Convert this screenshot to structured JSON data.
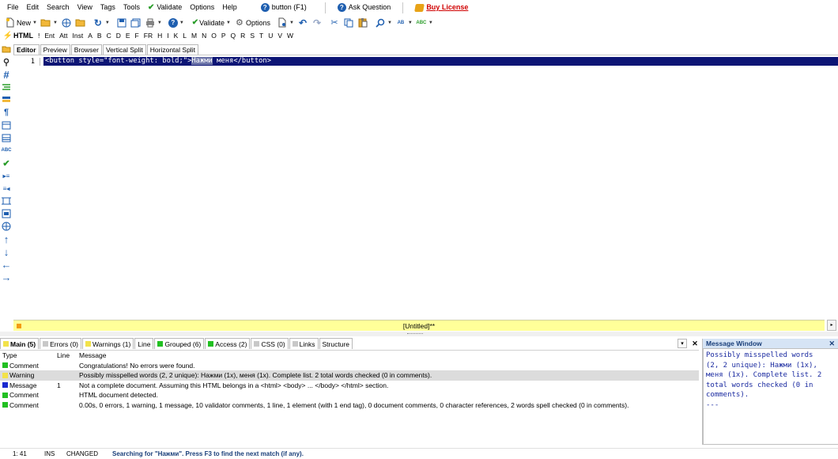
{
  "menu": {
    "file": "File",
    "edit": "Edit",
    "search": "Search",
    "view": "View",
    "tags": "Tags",
    "tools": "Tools",
    "validate": "Validate",
    "options": "Options",
    "help": "Help",
    "context_help": "button (F1)",
    "ask_question": "Ask Question",
    "buy_license": "Buy License"
  },
  "toolbar": {
    "new_label": "New",
    "validate_label": "Validate",
    "options_label": "Options"
  },
  "tagbar": {
    "items": [
      "HTML",
      "!",
      "Ent",
      "Att",
      "Inst",
      "A",
      "B",
      "C",
      "D",
      "E",
      "F",
      "FR",
      "H",
      "I",
      "K",
      "L",
      "M",
      "N",
      "O",
      "P",
      "Q",
      "R",
      "S",
      "T",
      "U",
      "V",
      "W"
    ]
  },
  "editor_tabs": [
    "Editor",
    "Preview",
    "Browser",
    "Vertical Split",
    "Horizontal Split"
  ],
  "editor": {
    "line_number": "1",
    "code_before": "<button style=\"font-weight: bold;\">",
    "code_highlight": "Нажми",
    "code_after": " меня</button>",
    "doc_title": "[Untitled]**"
  },
  "message_tabs": [
    {
      "label": "Main (5)",
      "color": "#f2e24a"
    },
    {
      "label": "Errors (0)",
      "color": "#c8c8c8"
    },
    {
      "label": "Warnings (1)",
      "color": "#f2e24a"
    },
    {
      "label": "Line",
      "color": ""
    },
    {
      "label": "Grouped (6)",
      "color": "#22c022"
    },
    {
      "label": "Access (2)",
      "color": "#22c022"
    },
    {
      "label": "CSS (0)",
      "color": "#c8c8c8"
    },
    {
      "label": "Links",
      "color": "#c8c8c8"
    },
    {
      "label": "Structure",
      "color": ""
    }
  ],
  "message_table": {
    "headers": {
      "type": "Type",
      "line": "Line",
      "message": "Message"
    },
    "rows": [
      {
        "type": "Comment",
        "line": "",
        "message": "Congratulations! No errors were found.",
        "color": "#22c022"
      },
      {
        "type": "Warning",
        "line": "",
        "message": "Possibly misspelled words (2, 2 unique): Нажми (1x), меня (1x). Complete list. 2 total words checked (0 in comments).",
        "color": "#f2e24a"
      },
      {
        "type": "Message",
        "line": "1",
        "message": "Not a complete document. Assuming this HTML belongs in a <html> <body> ... </body> </html> section.",
        "color": "#1a2ad0"
      },
      {
        "type": "Comment",
        "line": "",
        "message": "HTML document detected.",
        "color": "#22c022"
      },
      {
        "type": "Comment",
        "line": "",
        "message": "0.00s, 0 errors, 1 warning, 1 message, 10 validator comments, 1 line, 1 element (with 1 end tag), 0 document comments, 0 character references, 2 words spell checked (0 in comments).",
        "color": "#22c022"
      }
    ]
  },
  "message_window": {
    "title": "Message Window",
    "text": "Possibly misspelled words\n(2, 2 unique): Нажми (1x),\nменя (1x). Complete list. 2\ntotal words checked (0 in\ncomments).\n---"
  },
  "status": {
    "position": "1: 41",
    "mode": "INS",
    "state": "CHANGED",
    "message": "Searching for \"Нажми\". Press F3 to find the next match (if any)."
  }
}
